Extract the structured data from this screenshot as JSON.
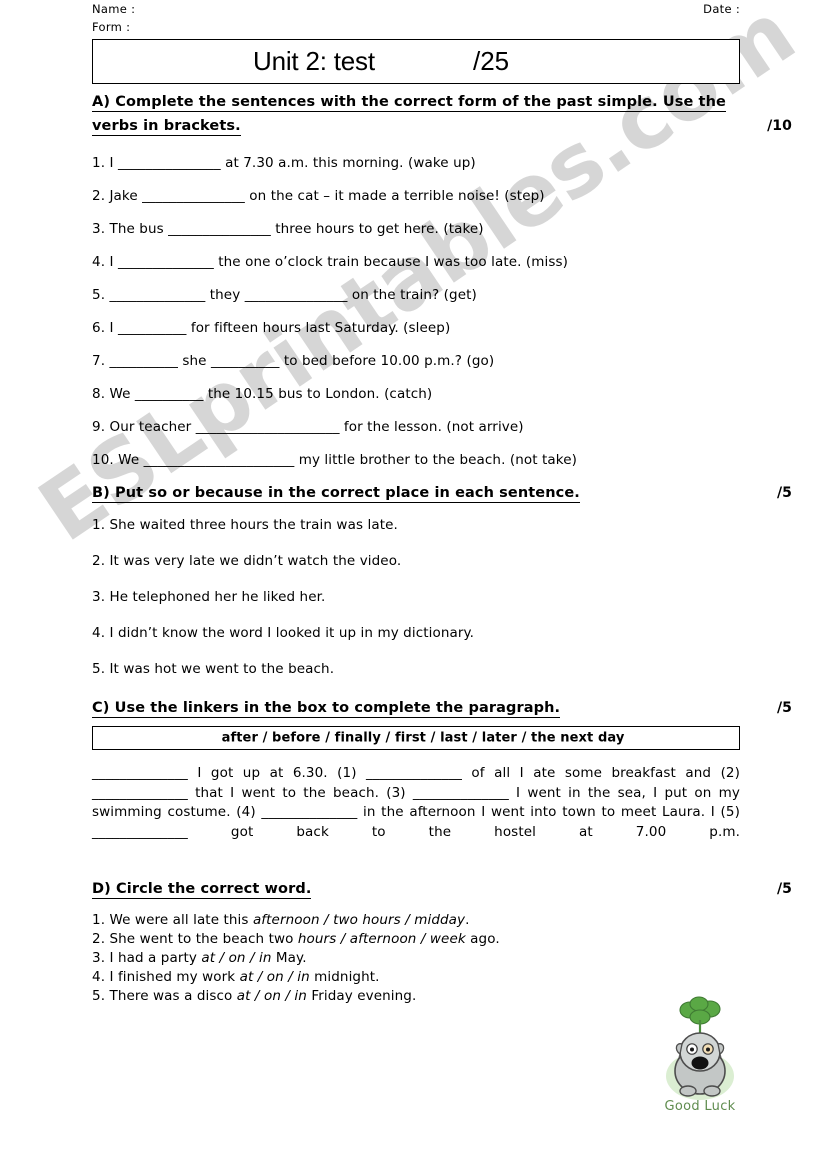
{
  "header": {
    "name_label": "Name :",
    "form_label": "Form :",
    "date_label": "Date :"
  },
  "title_box": {
    "title": "Unit 2: test",
    "total_score": "/25"
  },
  "watermark": {
    "text": "ESLprintables.com"
  },
  "sections": [
    {
      "id": "A",
      "heading_line1": "A) Complete the sentences with the correct form of the past simple. Use the",
      "heading_line2": "verbs in brackets.",
      "marks": "/10",
      "questions": [
        "1. I _______________ at 7.30 a.m. this morning. (wake up)",
        "2. Jake _______________ on the cat – it made a terrible noise! (step)",
        "3. The bus _______________ three hours to get here. (take)",
        "4. I ______________ the one o’clock train because I was too late. (miss)",
        "5. ______________ they _______________ on the train? (get)",
        "6. I __________ for fifteen hours last Saturday. (sleep)",
        "7. __________ she __________ to bed before 10.00 p.m.? (go)",
        "8. We __________ the 10.15 bus to London. (catch)",
        "9. Our teacher _____________________ for the lesson. (not arrive)",
        "10. We ______________________ my little brother to the beach.    (not take)"
      ]
    },
    {
      "id": "B",
      "heading_line1": "B) Put so or because in the correct place in each sentence.",
      "marks": "/5",
      "questions": [
        "1. She waited three hours the train was late.",
        "2. It was very late we didn’t watch the video.",
        "3. He telephoned her he liked her.",
        "4. I didn’t know the word I looked it up in my dictionary.",
        "5. It was hot we went to the beach."
      ]
    },
    {
      "id": "C",
      "heading_line1": "C) Use the linkers in the box to complete the paragraph.",
      "marks": "/5",
      "word_box": "after / before / finally / first / last / later / the next day",
      "paragraph": "______________ I got up at 6.30. (1) ______________ of all I ate some breakfast and (2) ______________ that I went to the beach. (3) ______________ I went in the sea, I put on my swimming costume. (4) ______________ in the afternoon I went into town to meet Laura. I (5) ______________ got back to the hostel at 7.00 p.m."
    },
    {
      "id": "D",
      "heading_line1": "D) Circle the correct word.",
      "marks": "/5",
      "questions": [
        {
          "pre": "1. We were all late this ",
          "italic": "afternoon / two hours / midday",
          "post": "."
        },
        {
          "pre": "2. She went to the beach two ",
          "italic": "hours / afternoon / week",
          "post": " ago."
        },
        {
          "pre": "3. I had a party ",
          "italic": "at / on / in",
          "post": " May."
        },
        {
          "pre": "4. I finished my work ",
          "italic": "at / on / in",
          "post": " midnight."
        },
        {
          "pre": "5. There was a disco ",
          "italic": "at / on / in",
          "post": " Friday evening."
        }
      ]
    }
  ],
  "mascot": {
    "label": "Good Luck",
    "clover_color": "#5aa845",
    "body_color": "#b8bcbb",
    "shadow_color": "#d9ead0",
    "text_color": "#5f8c4e"
  }
}
